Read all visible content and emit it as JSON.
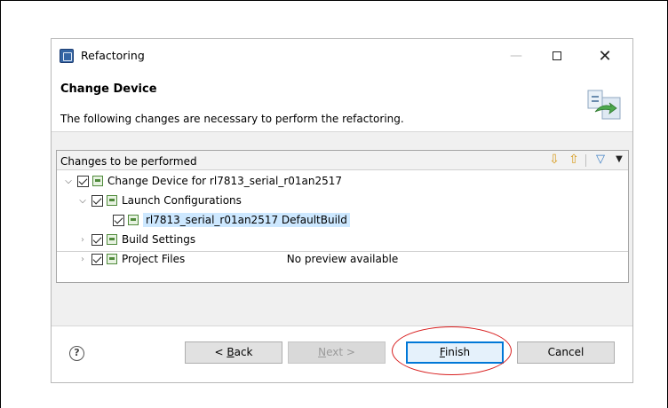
{
  "window": {
    "title": "Refactoring"
  },
  "header": {
    "title": "Change Device",
    "description": "The following changes are necessary to perform the refactoring."
  },
  "changes_panel": {
    "title": "Changes to be performed",
    "tree": [
      {
        "label": "Change Device for rl7813_serial_r01an2517",
        "expanded": true,
        "checked": true
      },
      {
        "label": "Launch Configurations",
        "expanded": true,
        "checked": true
      },
      {
        "label": "rl7813_serial_r01an2517 DefaultBuild",
        "selected": true,
        "checked": true
      },
      {
        "label": "Build Settings",
        "expanded": false,
        "checked": true
      },
      {
        "label": "Project Files",
        "expanded": false,
        "checked": true
      }
    ],
    "preview_text": "No preview available"
  },
  "buttons": {
    "back_prefix": "< ",
    "back_mnemonic": "B",
    "back_rest": "ack",
    "next_mnemonic": "N",
    "next_rest": "ext >",
    "finish_mnemonic": "F",
    "finish_rest": "inish",
    "cancel": "Cancel"
  },
  "colors": {
    "accent": "#0078d7",
    "highlight_ellipse": "#d81e1e",
    "selection": "#cde8ff"
  }
}
